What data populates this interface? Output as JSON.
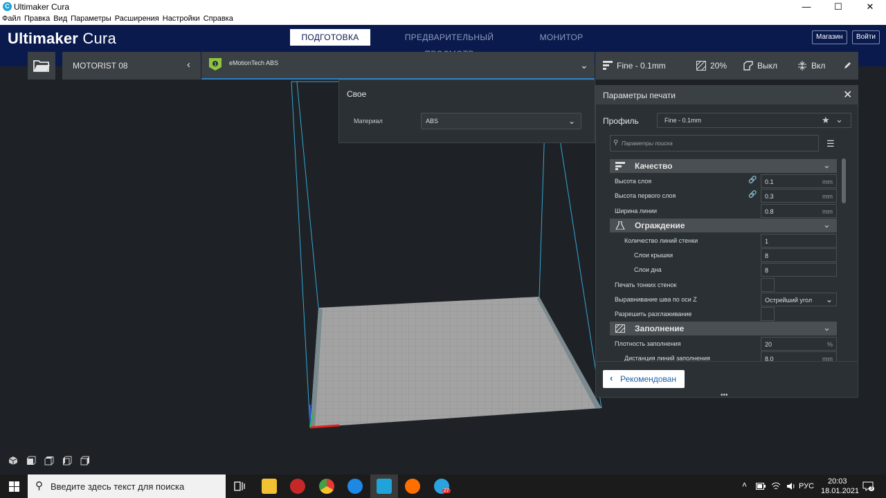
{
  "window": {
    "title": "Ultimaker Cura",
    "logo_letter": "C",
    "minimize": "—",
    "maximize": "☐",
    "close": "✕"
  },
  "menu": [
    "Файл",
    "Правка",
    "Вид",
    "Параметры",
    "Расширения",
    "Настройки",
    "Справка"
  ],
  "header": {
    "brand_bold": "Ultimaker",
    "brand_rest": " Cura",
    "stages": [
      "ПОДГОТОВКА",
      "ПРЕДВАРИТЕЛЬНЫЙ ПРОСМОТР",
      "МОНИТОР"
    ],
    "active_stage": "ПОДГОТОВКА",
    "marketplace": "Магазин",
    "signin": "Войти"
  },
  "toolbar": {
    "printer_name": "MOTORIST 08",
    "material_name": "eMotionTech ABS",
    "settings": {
      "profile": "Fine - 0.1mm",
      "infill": "20%",
      "support": "Выкл",
      "adhesion": "Вкл"
    }
  },
  "material_panel": {
    "heading": "Свое",
    "material_label": "Материал",
    "material_value": "ABS"
  },
  "print_settings": {
    "title": "Параметры печати",
    "close": "✕",
    "profile_label": "Профиль",
    "profile_value": "Fine - 0.1mm",
    "search_placeholder": "Параметры поиска",
    "categories": {
      "quality": "Качество",
      "shell": "Ограждение",
      "infill": "Заполнение"
    },
    "rows": {
      "layer_height": {
        "label": "Высота слоя",
        "value": "0.1",
        "unit": "mm"
      },
      "initial_layer_height": {
        "label": "Высота первого слоя",
        "value": "0.3",
        "unit": "mm"
      },
      "line_width": {
        "label": "Ширина линии",
        "value": "0.8",
        "unit": "mm"
      },
      "wall_line_count": {
        "label": "Количество линий стенки",
        "value": "1"
      },
      "top_layers": {
        "label": "Слои крышки",
        "value": "8"
      },
      "bottom_layers": {
        "label": "Слои дна",
        "value": "8"
      },
      "thin_walls": {
        "label": "Печать тонких стенок"
      },
      "z_seam": {
        "label": "Выравнивание шва по оси Z",
        "value": "Острейший угол"
      },
      "ironing": {
        "label": "Разрешить разглаживание"
      },
      "infill_density": {
        "label": "Плотность заполнения",
        "value": "20",
        "unit": "%"
      },
      "infill_line_distance": {
        "label": "Дистанция линий заполнения",
        "value": "8.0",
        "unit": "mm"
      }
    },
    "recommended_button": "Рекомендован",
    "grip": "•••"
  },
  "taskbar": {
    "search_placeholder": "Введите здесь текст для поиска",
    "telegram_badge": "27",
    "tray": {
      "language": "РУС",
      "time": "20:03",
      "date": "18.01.2021",
      "notifications": "3"
    }
  }
}
